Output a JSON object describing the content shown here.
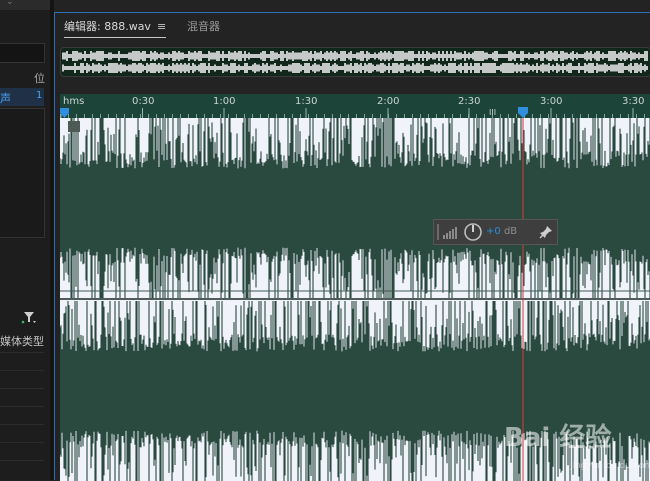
{
  "left_panel": {
    "label_position": "位",
    "item_label": "声",
    "item_count": "1",
    "media_type_label": "媒体类型"
  },
  "editor": {
    "tabs": [
      {
        "label": "编辑器: 888.wav",
        "menu_icon": "≡"
      },
      {
        "label": "混音器"
      }
    ],
    "timeline": {
      "unit_label": "hms",
      "ticks": [
        "0:30",
        "1:00",
        "1:30",
        "2:00",
        "2:30",
        "3:00",
        "3:30"
      ],
      "playhead": "2:50"
    },
    "hud": {
      "gain_value": "+0",
      "gain_unit": "dB"
    }
  },
  "watermark": {
    "text": "Bai 经验"
  },
  "colors": {
    "waveform": "#2b4a3f",
    "background": "#f1f3fb",
    "ruler": "#1c4438",
    "playhead": "#d9363e",
    "accent": "#2f8fde"
  }
}
